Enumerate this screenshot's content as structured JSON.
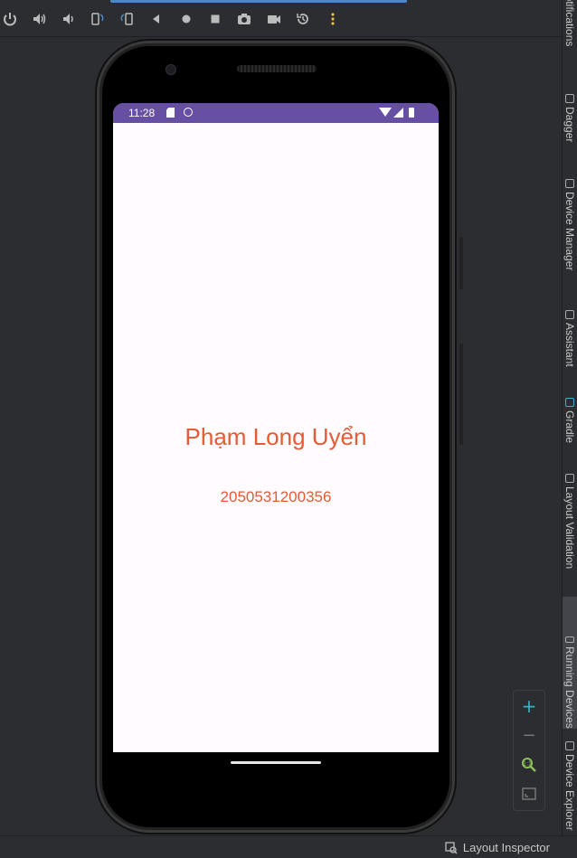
{
  "toolbar": {
    "buttons": [
      {
        "name": "power-icon",
        "glyph": "⏻"
      },
      {
        "name": "volume-up-icon",
        "glyph": "🔊"
      },
      {
        "name": "volume-down-icon",
        "glyph": "🔉"
      },
      {
        "name": "rotate-left-icon",
        "glyph": "⟲"
      },
      {
        "name": "rotate-right-icon",
        "glyph": "⟳"
      },
      {
        "name": "back-icon",
        "glyph": "◀"
      },
      {
        "name": "home-icon",
        "glyph": "●"
      },
      {
        "name": "overview-icon",
        "glyph": "■"
      },
      {
        "name": "screenshot-icon",
        "glyph": "📷"
      },
      {
        "name": "screen-record-icon",
        "glyph": "🎥"
      },
      {
        "name": "snapshot-icon",
        "glyph": "↺"
      },
      {
        "name": "more-icon",
        "glyph": "⋮"
      }
    ]
  },
  "right_tabs": [
    {
      "label": "Notifications",
      "icon": "bell-icon"
    },
    {
      "label": "Dagger",
      "icon": "dagger-icon"
    },
    {
      "label": "Device Manager",
      "icon": "device-icon"
    },
    {
      "label": "Assistant",
      "icon": "assistant-icon"
    },
    {
      "label": "Gradle",
      "icon": "gradle-icon"
    },
    {
      "label": "Layout Validation",
      "icon": "layout-validation-icon"
    },
    {
      "label": "Running Devices",
      "icon": "running-devices-icon"
    },
    {
      "label": "Device Explorer",
      "icon": "device-explorer-icon"
    }
  ],
  "device": {
    "status_time": "11:28",
    "title_text": "Phạm Long Uyển",
    "id_text": "2050531200356",
    "text_color": "#e45b35",
    "status_bar_color": "#6750a4"
  },
  "zoom_panel": {
    "plus": "+",
    "minus": "−"
  },
  "status_bar": {
    "layout_inspector": "Layout Inspector"
  },
  "colors": {
    "ide_bg": "#2b2d30",
    "accent": "#4a88c7"
  }
}
